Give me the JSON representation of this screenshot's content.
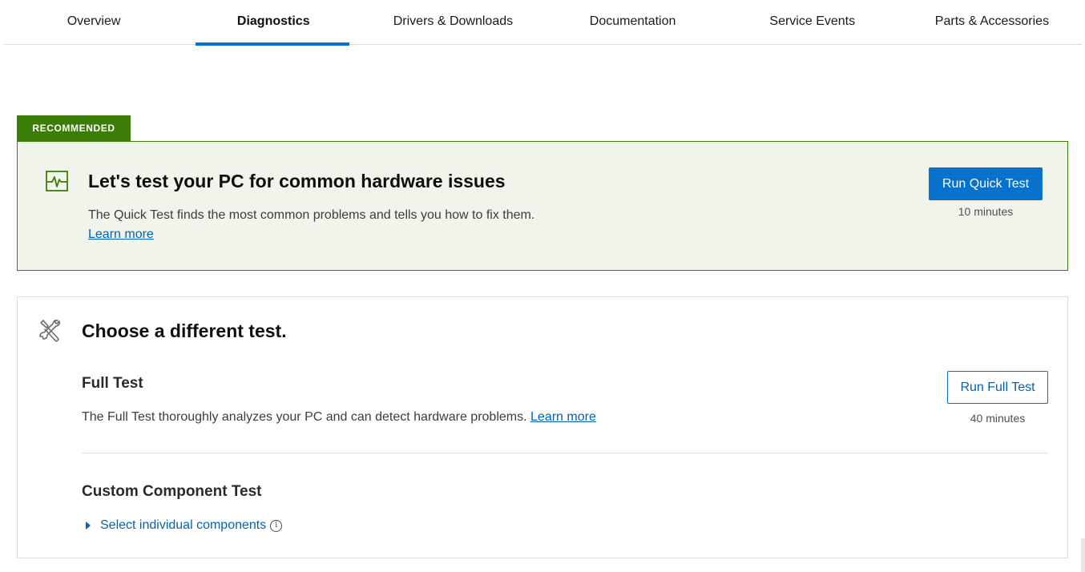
{
  "tabs": [
    {
      "label": "Overview",
      "active": false
    },
    {
      "label": "Diagnostics",
      "active": true
    },
    {
      "label": "Drivers & Downloads",
      "active": false
    },
    {
      "label": "Documentation",
      "active": false
    },
    {
      "label": "Service Events",
      "active": false
    },
    {
      "label": "Parts & Accessories",
      "active": false
    }
  ],
  "recommended": {
    "badge": "RECOMMENDED",
    "icon": "pulse-monitor-icon",
    "title": "Let's test your PC for common hardware issues",
    "description": "The Quick Test finds the most common problems and tells you how to fix them.",
    "learn_more": "Learn more",
    "button": "Run Quick Test",
    "duration": "10 minutes"
  },
  "other_tests": {
    "icon": "tools-icon",
    "title": "Choose a different test.",
    "full_test": {
      "title": "Full Test",
      "description": "The Full Test thoroughly analyzes your PC and can detect hardware problems.",
      "learn_more": "Learn more",
      "button": "Run Full Test",
      "duration": "40 minutes"
    },
    "custom_test": {
      "title": "Custom Component Test",
      "select_label": "Select individual components",
      "info_symbol": "i"
    }
  },
  "colors": {
    "accent_blue": "#0672cb",
    "link_blue": "#0063b8",
    "recommended_green": "#3b7d08",
    "recommended_bg": "#f0f4ea"
  }
}
